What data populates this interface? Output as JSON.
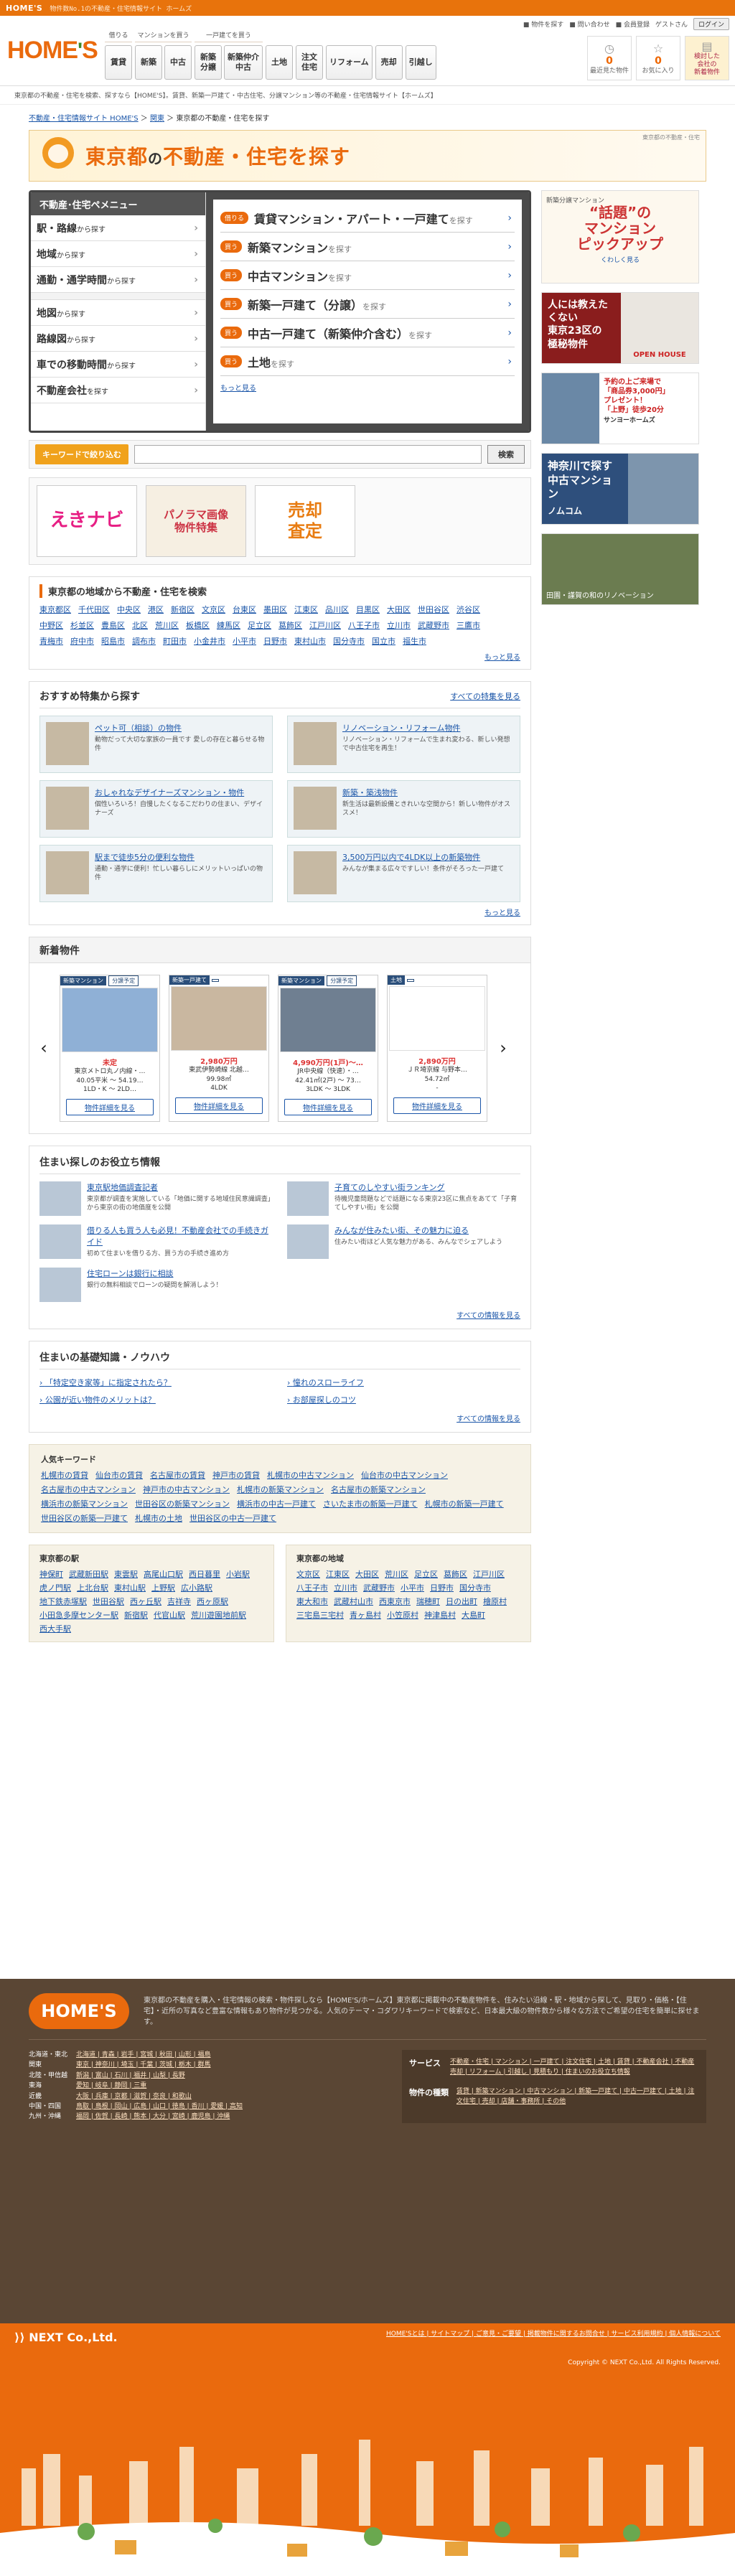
{
  "topbar": {
    "logo": "HOME'S",
    "tagline": "物件数No.1の不動産・住宅情報サイト ホームズ"
  },
  "header": {
    "logo_main": "HOME",
    "logo_apos": "'",
    "logo_end": "S",
    "nav_heads": [
      "借りる",
      "マンションを買う",
      "一戸建てを買う"
    ],
    "nav": [
      {
        "group": "借りる",
        "buttons": [
          "賃貸"
        ]
      },
      {
        "group": "マンションを買う",
        "buttons": [
          "新築",
          "中古"
        ]
      },
      {
        "group": "一戸建てを買う",
        "buttons": [
          "新築\n分譲",
          "新築仲介\n中古"
        ]
      },
      {
        "group": "",
        "buttons": [
          "土地"
        ]
      },
      {
        "group": "",
        "buttons": [
          "注文\n住宅"
        ]
      },
      {
        "group": "",
        "buttons": [
          "リフォーム"
        ]
      },
      {
        "group": "",
        "buttons": [
          "売却"
        ]
      },
      {
        "group": "",
        "buttons": [
          "引越し"
        ]
      }
    ],
    "links": [
      "■ 物件を探す",
      "■ 問い合わせ",
      "■ 会員登録",
      "ゲストさん"
    ],
    "login": "ログイン",
    "icons": [
      {
        "label": "最近見た物件",
        "num": "0",
        "icon": "clock-icon"
      },
      {
        "label": "お気に入り",
        "num": "0",
        "icon": "star-icon"
      },
      {
        "label": "検討した\n会社の\n新着物件",
        "num": "",
        "icon": "note-icon"
      }
    ]
  },
  "subline": "東京都の不動産・住宅を検索、探すなら【HOME'S】。賃貸、新築一戸建て・中古住宅、分譲マンション等の不動産・住宅情報サイト【ホームズ】",
  "breadcrumbs": [
    "不動産・住宅情報サイト HOME'S",
    "関東",
    "東京都の不動産・住宅を探す"
  ],
  "title": {
    "pre": "東京都",
    "mid": "の",
    "main": "不動産・住宅を探す",
    "note": "東京都の不動産・住宅"
  },
  "menu": {
    "header": "不動産･住宅ペメニュー",
    "items": [
      {
        "main": "駅・路線",
        "sub": "から探す"
      },
      {
        "main": "地域",
        "sub": "から探す"
      },
      {
        "main": "通勤・通学時間",
        "sub": "から探す"
      },
      {
        "main": "地図",
        "sub": "から探す"
      },
      {
        "main": "路線図",
        "sub": "から探す"
      },
      {
        "main": "車での移動時間",
        "sub": "から探す"
      },
      {
        "main": "不動産会社",
        "sub": "を探す"
      }
    ]
  },
  "panel": {
    "items": [
      {
        "tag": "借りる",
        "label": "賃貸マンション・アパート・一戸建て",
        "sfx": "を探す"
      },
      {
        "tag": "買う",
        "label": "新築マンション",
        "sfx": "を探す"
      },
      {
        "tag": "買う",
        "label": "中古マンション",
        "sfx": "を探す"
      },
      {
        "tag": "買う",
        "label": "新築一戸建て（分譲）",
        "sfx": "を探す"
      },
      {
        "tag": "買う",
        "label": "中古一戸建て（新築仲介含む）",
        "sfx": "を探す"
      },
      {
        "tag": "買う",
        "label": "土地",
        "sfx": "を探す"
      }
    ],
    "more": "もっと見る"
  },
  "keyword": {
    "label": "キーワードで絞り込む",
    "placeholder": "",
    "button": "検索"
  },
  "banners": [
    {
      "name": "ekinavi-banner",
      "text": "えきナビ"
    },
    {
      "name": "panorama-banner",
      "text": "パノラマ画像\n物件特集"
    },
    {
      "name": "baikyaku-banner",
      "text": "売却\n査定"
    }
  ],
  "areas": {
    "title": "東京都の地域から不動産・住宅を検索",
    "cities": [
      "東京都区",
      "千代田区",
      "中央区",
      "港区",
      "新宿区",
      "文京区",
      "台東区",
      "墨田区",
      "江東区",
      "品川区",
      "目黒区",
      "大田区",
      "世田谷区",
      "渋谷区",
      "中野区",
      "杉並区",
      "豊島区",
      "北区",
      "荒川区",
      "板橋区",
      "練馬区",
      "足立区",
      "葛飾区",
      "江戸川区",
      "八王子市",
      "立川市",
      "武蔵野市",
      "三鷹市",
      "青梅市",
      "府中市",
      "昭島市",
      "調布市",
      "町田市",
      "小金井市",
      "小平市",
      "日野市",
      "東村山市",
      "国分寺市",
      "国立市",
      "福生市"
    ],
    "more": "もっと見る"
  },
  "features": {
    "title": "おすすめ特集から探す",
    "all": "すべての特集を見る",
    "items": [
      {
        "title": "ペット可（相談）の物件",
        "desc": "動物だって大切な家族の一員です\n愛しの存在と暮らせる物件"
      },
      {
        "title": "リノベーション・リフォーム物件",
        "desc": "リノベーション・リフォームで生まれ変わる、新しい発想で中古住宅を再生！"
      },
      {
        "title": "おしゃれなデザイナーズマンション・物件",
        "desc": "個性いろいろ！自慢したくなるこだわりの住まい、デザイナーズ"
      },
      {
        "title": "新築・築浅物件",
        "desc": "新生活は最新設備ときれいな空間から！新しい物件がオススメ！"
      },
      {
        "title": "駅まで徒歩5分の便利な物件",
        "desc": "通勤・通学に便利！忙しい暮らしにメリットいっぱいの物件"
      },
      {
        "title": "3,500万円以内で4LDK以上の新築物件",
        "desc": "みんなが集まる広々ですしい！条件がそろった一戸建て"
      }
    ],
    "more": "もっと見る"
  },
  "newprops": {
    "title": "新着物件",
    "cards": [
      {
        "tag": "新築マンション",
        "tag2": "分譲予定",
        "price": "未定",
        "line1": "東京メトロ丸ノ内線・…",
        "line2": "40.05平米 〜 54.19…",
        "line3": "1LD・K 〜 2LD…",
        "btn": "物件詳細を見る"
      },
      {
        "tag": "新築一戸建て",
        "tag2": "",
        "price": "2,980万円",
        "line1": "東武伊勢崎線 北越…",
        "line2": "99.98㎡",
        "line3": "4LDK",
        "btn": "物件詳細を見る"
      },
      {
        "tag": "新築マンション",
        "tag2": "分譲予定",
        "price": "4,990万円(1戸)〜…",
        "line1": "JR中央線（快速）・…",
        "line2": "42.41㎡(2戸) 〜 73…",
        "line3": "3LDK 〜 3LDK",
        "btn": "物件詳細を見る"
      },
      {
        "tag": "土地",
        "tag2": "",
        "price": "2,890万円",
        "line1": "ＪＲ埼京線 与野本…",
        "line2": "54.72㎡",
        "line3": "-",
        "btn": "物件詳細を見る"
      }
    ]
  },
  "info": {
    "title": "住まい探しのお役立ち情報",
    "items": [
      {
        "title": "東京駅地価調査記者",
        "desc": "東京都が調査を実施している「地価に関する地域住民意識調査」から東京の街の地価度を公開"
      },
      {
        "title": "子育てのしやすい街ランキング",
        "desc": "待機児童問題などで話題になる東京23区に焦点をあてて「子育てしやすい街」を公開"
      },
      {
        "title": "借りる人も買う人も必見！不動産会社での手続きガイド",
        "desc": "初めて住まいを借りる方、買う方の手続き進め方"
      },
      {
        "title": "みんなが住みたい街、その魅力に迫る",
        "desc": "住みたい街ほど人気な魅力がある、みんなでシェアしよう"
      },
      {
        "title": "住宅ローンは銀行に相談",
        "desc": "銀行の無料相談でローンの疑問を解消しよう！"
      }
    ],
    "all": "すべての情報を見る"
  },
  "knowhow": {
    "title": "住まいの基礎知識・ノウハウ",
    "items": [
      "「特定空き家等」に指定されたら？",
      "憧れのスローライフ",
      "公園が近い物件のメリットは？",
      "お部屋探しのコツ"
    ],
    "all": "すべての情報を見る"
  },
  "popular": {
    "title": "人気キーワード",
    "items": [
      "札幌市の賃貸",
      "仙台市の賃貸",
      "名古屋市の賃貸",
      "神戸市の賃貸",
      "札幌市の中古マンション",
      "仙台市の中古マンション",
      "名古屋市の中古マンション",
      "神戸市の中古マンション",
      "札幌市の新築マンション",
      "名古屋市の新築マンション",
      "横浜市の新築マンション",
      "世田谷区の新築マンション",
      "横浜市の中古一戸建て",
      "さいたま市の新築一戸建て",
      "札幌市の新築一戸建て",
      "世田谷区の新築一戸建て",
      "札幌市の土地",
      "世田谷区の中古一戸建て"
    ]
  },
  "stations": {
    "title": "東京都の駅",
    "items": [
      "神保町",
      "武蔵新田駅",
      "東雲駅",
      "高尾山口駅",
      "西日暮里",
      "小岩駅",
      "虎ノ門駅",
      "上北台駅",
      "東村山駅",
      "上野駅",
      "広小路駅",
      "地下鉄赤塚駅",
      "世田谷駅",
      "西ヶ丘駅",
      "吉祥寺",
      "西ヶ原駅",
      "小田急多摩センター駅",
      "新宿駅",
      "代官山駅",
      "荒川遊園地前駅",
      "西大手駅"
    ]
  },
  "regions": {
    "title": "東京都の地域",
    "items": [
      "文京区",
      "江東区",
      "大田区",
      "荒川区",
      "足立区",
      "葛飾区",
      "江戸川区",
      "八王子市",
      "立川市",
      "武蔵野市",
      "小平市",
      "日野市",
      "国分寺市",
      "東大和市",
      "武蔵村山市",
      "西東京市",
      "瑞穂町",
      "日の出町",
      "檜原村",
      "三宅島三宅村",
      "青ヶ島村",
      "小笠原村",
      "神津島村",
      "大島町"
    ]
  },
  "sidebar": {
    "ad1": {
      "small": "新築分譲マンション",
      "big": "“話題”の\nマンション\nピックアップ",
      "link": "くわしく見る"
    },
    "ad2": {
      "left": "人には教えたくない\n東京23区の\n極秘物件",
      "right": "OPEN HOUSE"
    },
    "ad3": {
      "text": "予約の上ご来場で\n「商品券3,000円」\nプレゼント！\n「上野」徒歩20分",
      "sub": "サンヨーホームズ"
    },
    "ad4": {
      "text": "神奈川で探す\n中古マンション",
      "sub": "ノムコム"
    },
    "ad5": {
      "text": "田園・謹賀の和のリノベーション"
    }
  },
  "footer": {
    "logo": "HOME'S",
    "intro": "東京都の不動産を購入・住宅情報の検索・物件探しなら【HOME'S/ホームズ】東京都に掲載中の不動産物件を、住みたい沿線・駅・地域から探して、見取り・価格・【住宅】・近所の写真など豊富な情報もあり物件が見つかる。人気のテーマ・コダワリキーワードで検索など、日本最大級の物件数から様々な方法でご希望の住宅を簡単に探せます。",
    "regions": [
      {
        "h": "北海道・東北",
        "l": "北海道 | 青森 | 岩手 | 宮城 | 秋田 | 山形 | 福島"
      },
      {
        "h": "関東",
        "l": "東京 | 神奈川 | 埼玉 | 千葉 | 茨城 | 栃木 | 群馬"
      },
      {
        "h": "北陸・甲信越",
        "l": "新潟 | 富山 | 石川 | 福井 | 山梨 | 長野"
      },
      {
        "h": "東海",
        "l": "愛知 | 岐阜 | 静岡 | 三重"
      },
      {
        "h": "近畿",
        "l": "大阪 | 兵庫 | 京都 | 滋賀 | 奈良 | 和歌山"
      },
      {
        "h": "中国・四国",
        "l": "鳥取 | 島根 | 岡山 | 広島 | 山口 | 徳島 | 香川 | 愛媛 | 高知"
      },
      {
        "h": "九州・沖縄",
        "l": "福岡 | 佐賀 | 長崎 | 熊本 | 大分 | 宮崎 | 鹿児島 | 沖縄"
      }
    ],
    "services": {
      "h": "サービス",
      "l": "不動産・住宅 | マンション | 一戸建て | 注文住宅 | 土地 | 賃貸 | 不動産会社 | 不動産売却 | リフォーム | 引越し | 見積もり | 住まいのお役立ち情報"
    },
    "kinds": {
      "h": "物件の種類",
      "l": "賃貸 | 新築マンション | 中古マンション | 新築一戸建て | 中古一戸建て | 土地 | 注文住宅 | 売却 | 店舗・事務所 | その他"
    },
    "company": "NEXT Co.,Ltd.",
    "links": "HOME'Sとは | サイトマップ | ご意見・ご要望 | 掲載物件に関するお問合せ | サービス利用規約 | 個人情報について",
    "copyright": "Copyright © NEXT Co.,Ltd. All Rights Reserved."
  }
}
